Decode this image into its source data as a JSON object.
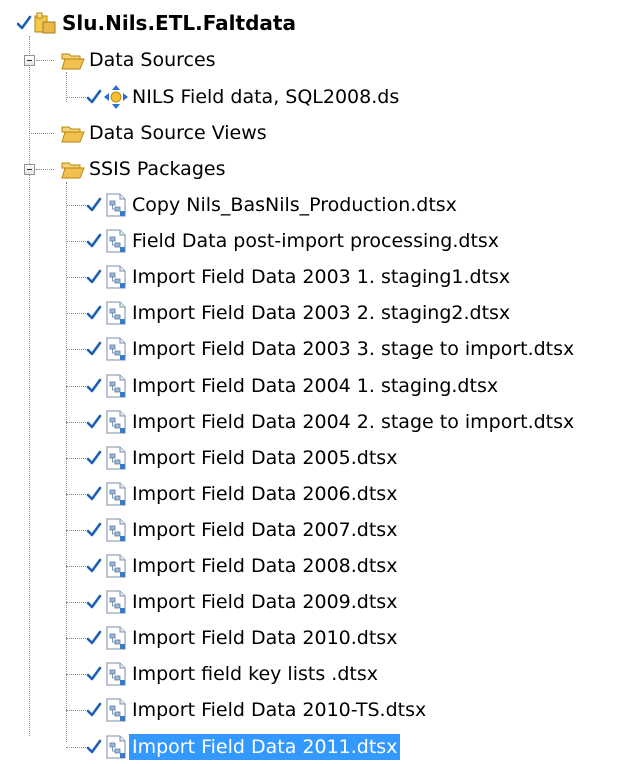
{
  "tree": {
    "root": {
      "label": "Slu.Nils.ETL.Faltdata",
      "icon": "project-icon"
    },
    "folders": [
      {
        "label": "Data Sources",
        "icon": "folder-open-icon",
        "expanded": true,
        "items": [
          {
            "label": "NILS Field data, SQL2008.ds",
            "icon": "data-source-icon"
          }
        ]
      },
      {
        "label": "Data Source Views",
        "icon": "folder-open-icon",
        "expanded": false,
        "items": []
      },
      {
        "label": "SSIS Packages",
        "icon": "folder-open-icon",
        "expanded": true,
        "items": [
          {
            "label": "Copy Nils_BasNils_Production.dtsx",
            "icon": "ssis-package-icon"
          },
          {
            "label": "Field Data post-import processing.dtsx",
            "icon": "ssis-package-icon"
          },
          {
            "label": "Import Field Data 2003 1. staging1.dtsx",
            "icon": "ssis-package-icon"
          },
          {
            "label": "Import Field Data 2003 2. staging2.dtsx",
            "icon": "ssis-package-icon"
          },
          {
            "label": "Import Field Data 2003 3. stage to import.dtsx",
            "icon": "ssis-package-icon"
          },
          {
            "label": "Import Field Data 2004 1. staging.dtsx",
            "icon": "ssis-package-icon"
          },
          {
            "label": "Import Field Data 2004 2. stage to import.dtsx",
            "icon": "ssis-package-icon"
          },
          {
            "label": "Import Field Data 2005.dtsx",
            "icon": "ssis-package-icon"
          },
          {
            "label": "Import Field Data 2006.dtsx",
            "icon": "ssis-package-icon"
          },
          {
            "label": "Import Field Data 2007.dtsx",
            "icon": "ssis-package-icon"
          },
          {
            "label": "Import Field Data 2008.dtsx",
            "icon": "ssis-package-icon"
          },
          {
            "label": "Import Field Data 2009.dtsx",
            "icon": "ssis-package-icon"
          },
          {
            "label": "Import Field Data 2010.dtsx",
            "icon": "ssis-package-icon"
          },
          {
            "label": "Import field key lists .dtsx",
            "icon": "ssis-package-icon"
          },
          {
            "label": "Import Field Data 2010-TS.dtsx",
            "icon": "ssis-package-icon"
          },
          {
            "label": "Import Field Data 2011.dtsx",
            "icon": "ssis-package-icon",
            "selected": true
          }
        ]
      }
    ]
  },
  "colors": {
    "selection_background": "#3399ff",
    "selection_text": "#ffffff",
    "checkmark": "#1e5fb4",
    "folder": "#e8b84a",
    "tree_lines": "#8a8a8a"
  }
}
